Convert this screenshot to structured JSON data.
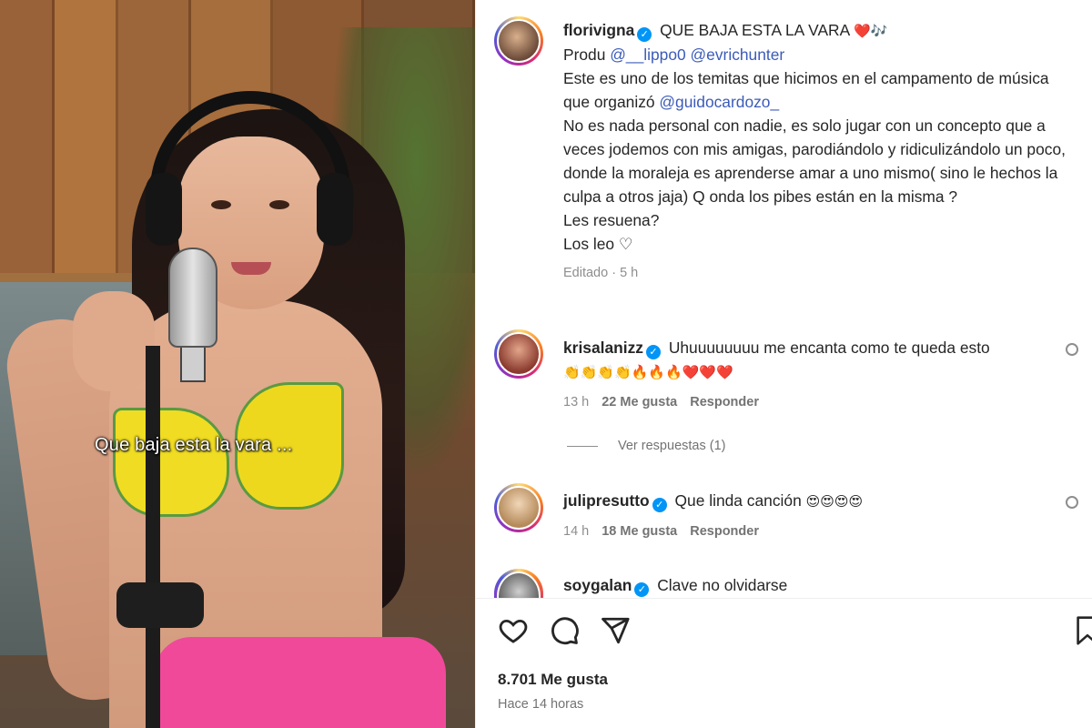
{
  "video": {
    "caption": "Que baja esta la vara ..."
  },
  "post": {
    "username": "florivigna",
    "title": "QUE BAJA ESTA LA VARA",
    "title_emojis": "❤️🎶",
    "produ_label": "Produ",
    "produ_mentions": [
      "@__lippo0",
      "@evrichunter"
    ],
    "body_line1": "Este es uno de los temitas que hicimos en el campamento de música que organizó",
    "body_mention": "@guidocardozo_",
    "body_line2": "No es nada personal con nadie, es solo jugar con un concepto que a veces jodemos con mis amigas, parodiándolo y ridiculizándolo un poco, donde la moraleja es aprenderse amar a uno mismo( sino le hechos la culpa a otros jaja) Q onda los pibes están en la misma ?",
    "body_line3": "Les resuena?",
    "body_line4": "Los leo ♡",
    "edited_meta": "Editado · 5 h"
  },
  "comments": [
    {
      "username": "krisalanizz",
      "text": "Uhuuuuuuuu me encanta como te queda esto",
      "emojis": "👏👏👏👏🔥🔥🔥❤️❤️❤️",
      "age": "13 h",
      "likes": "22 Me gusta",
      "reply": "Responder"
    },
    {
      "username": "julipresutto",
      "text": "Que linda canción",
      "emojis": "😍😍😍😍",
      "age": "14 h",
      "likes": "18 Me gusta",
      "reply": "Responder"
    },
    {
      "username": "soygalan",
      "text": "Clave no olvidarse"
    }
  ],
  "view_replies": "Ver respuestas (1)",
  "footer": {
    "likes": "8.701 Me gusta",
    "time": "Hace 14 horas"
  },
  "icons": [
    "heart-icon",
    "comment-icon",
    "share-icon",
    "bookmark-icon",
    "verified-icon"
  ],
  "colors": {
    "verified": "#0095f6",
    "mention": "#3b5bb8",
    "heart": "#e0245e"
  }
}
